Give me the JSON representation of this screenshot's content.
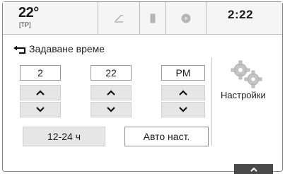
{
  "status": {
    "temperature": "22°",
    "mode": "[TP]",
    "clock": "2:22"
  },
  "icons": {
    "tab1": "music-note-icon",
    "tab2": "phone-icon",
    "tab3": "globe-icon",
    "back": "back-arrow-icon",
    "settings": "gears-icon",
    "scroll": "chevron-up-icon"
  },
  "header": {
    "title": "Задаване време"
  },
  "time": {
    "hour": "2",
    "minute": "22",
    "ampm": "PM"
  },
  "buttons": {
    "format": "12-24 ч",
    "auto": "Авто наст.",
    "settings": "Настройки"
  },
  "colors": {
    "button_bg": "#e6e6e6",
    "border": "#9a9a9a",
    "tab_dark": "#4a4a4a"
  }
}
